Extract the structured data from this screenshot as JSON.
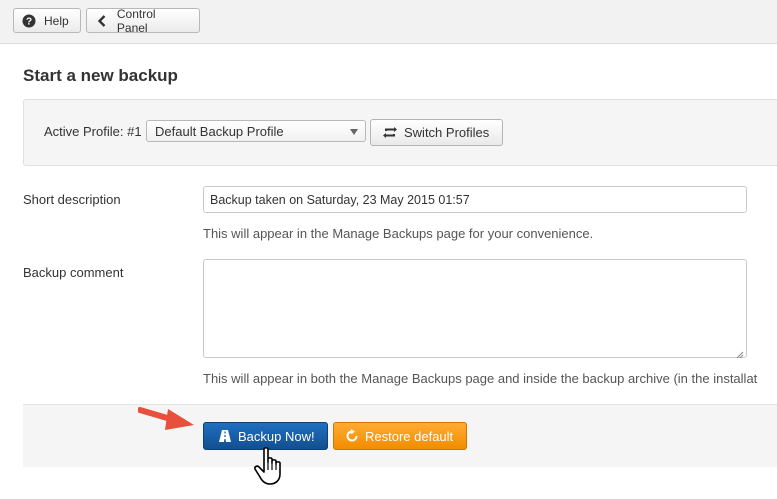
{
  "toolbar": {
    "help_label": "Help",
    "control_panel_label": "Control Panel"
  },
  "main": {
    "heading": "Start a new backup"
  },
  "profile": {
    "label": "Active Profile: #1",
    "selected_profile": "Default Backup Profile",
    "switch_label": "Switch Profiles"
  },
  "form": {
    "short_description": {
      "label": "Short description",
      "value": "Backup taken on Saturday, 23 May 2015 01:57",
      "help": "This will appear in the Manage Backups page for your convenience."
    },
    "backup_comment": {
      "label": "Backup comment",
      "value": "",
      "help": "This will appear in both the Manage Backups page and inside the backup archive (in the installat"
    }
  },
  "actions": {
    "backup_now_label": "Backup Now!",
    "restore_default_label": "Restore default"
  },
  "icons": {
    "help": "question-circle-icon",
    "control_panel": "chevron-left-icon",
    "switch": "refresh-icon",
    "backup": "road-icon",
    "restore": "rotate-icon",
    "pointer_arrow": "red-arrow-annotation",
    "cursor": "hand-pointer-cursor"
  },
  "colors": {
    "primary": "#1a5ea8",
    "warning": "#f59b1c",
    "annotation_arrow": "#e8503b"
  }
}
